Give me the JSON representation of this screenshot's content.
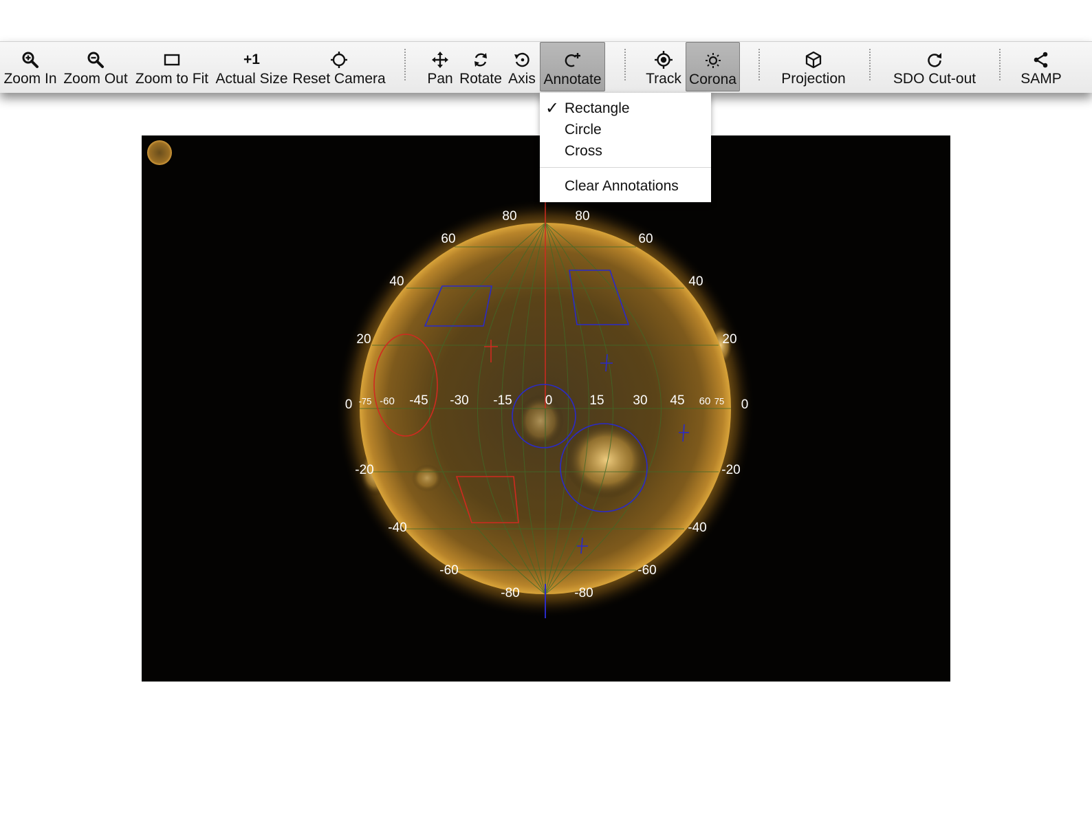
{
  "toolbar": {
    "zoom_in": "Zoom In",
    "zoom_out": "Zoom Out",
    "zoom_fit": "Zoom to Fit",
    "actual_size": "Actual Size",
    "actual_size_glyph": "+1",
    "reset_camera": "Reset Camera",
    "pan": "Pan",
    "rotate": "Rotate",
    "axis": "Axis",
    "annotate": "Annotate",
    "track": "Track",
    "corona": "Corona",
    "projection": "Projection",
    "sdo_cutout": "SDO Cut-out",
    "samp": "SAMP"
  },
  "annotate_menu": {
    "check_mark": "✓",
    "selected": "Rectangle",
    "items": [
      "Rectangle",
      "Circle",
      "Cross"
    ],
    "clear": "Clear Annotations"
  },
  "grid_labels": {
    "lat_left": [
      "80",
      "60",
      "40",
      "20",
      "0",
      "-20",
      "-40",
      "-60",
      "-80"
    ],
    "lat_right": [
      "80",
      "60",
      "40",
      "20",
      "0",
      "-20",
      "-40",
      "-60",
      "-80"
    ],
    "equator": [
      "-75",
      "-60",
      "-45",
      "-30",
      "-15",
      "0",
      "15",
      "30",
      "45",
      "60",
      "75"
    ]
  },
  "colors": {
    "toolbar_bg": "#eeeeee",
    "active_button": "#aaaaaa",
    "sun_core": "#6a4c18",
    "sun_limb": "#c8952e",
    "annotation_blue": "#2a2ac8",
    "annotation_red": "#d02a20",
    "grid_green": "#3f6a28"
  },
  "icons": {
    "zoom_in": "zoom-in-icon",
    "zoom_out": "zoom-out-icon",
    "zoom_fit": "zoom-fit-icon",
    "reset_camera": "crosshair-icon",
    "pan": "pan-arrows-icon",
    "rotate": "rotate-icon",
    "axis": "axis-rotate-icon",
    "annotate": "annotate-icon",
    "track": "track-target-icon",
    "corona": "sun-icon",
    "projection": "cube-icon",
    "sdo_cutout": "refresh-icon",
    "samp": "share-icon"
  }
}
